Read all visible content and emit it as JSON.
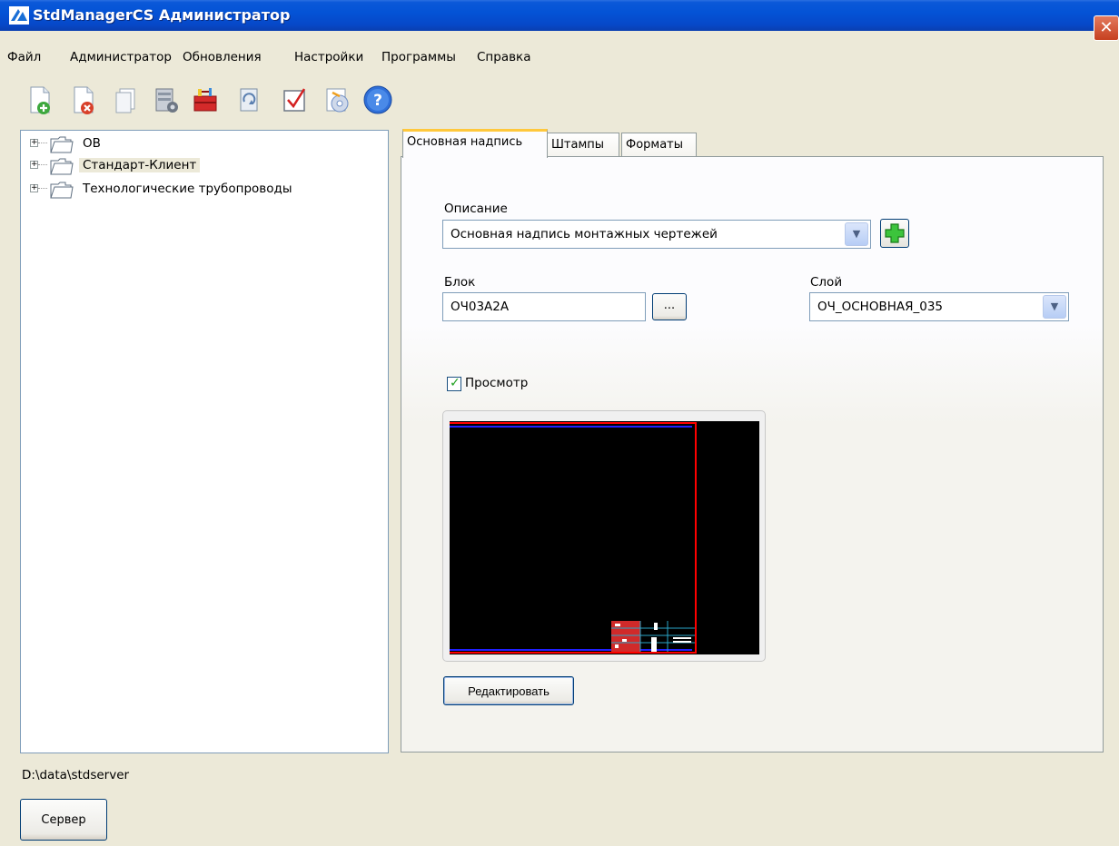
{
  "window": {
    "title": "StdManagerCS Администратор",
    "close_glyph": "✕"
  },
  "menu": [
    "Файл",
    "Администратор",
    "Обновления",
    "Настройки",
    "Программы",
    "Справка"
  ],
  "toolbar_icons": [
    "new-document-icon",
    "delete-document-icon",
    "copy-icon",
    "server-settings-icon",
    "toolbox-icon",
    "update-icon",
    "checklist-icon",
    "install-icon",
    "help-icon"
  ],
  "tree": {
    "nodes": [
      {
        "label": "ОВ",
        "selected": false
      },
      {
        "label": "Стандарт-Клиент",
        "selected": true
      },
      {
        "label": "Технологические трубопроводы",
        "selected": false
      }
    ]
  },
  "status": {
    "path": "D:\\data\\stdserver"
  },
  "server_button": "Сервер",
  "tabs": [
    {
      "label": "Основная надпись",
      "active": true
    },
    {
      "label": "Штампы",
      "active": false
    },
    {
      "label": "Форматы",
      "active": false
    }
  ],
  "form": {
    "description_label": "Описание",
    "description_value": "Основная надпись монтажных чертежей",
    "block_label": "Блок",
    "block_value": "ОЧ03А2А",
    "browse_label": "...",
    "layer_label": "Слой",
    "layer_value": "ОЧ_ОСНОВНАЯ_035",
    "preview_label": "Просмотр",
    "preview_checked": true,
    "edit_button": "Редактировать"
  },
  "colors": {
    "titlebar": "#0453d6",
    "window_bg": "#ece9d8",
    "preview_bg": "#000000",
    "frame_red": "#ff0000",
    "frame_blue": "#0000ff"
  }
}
